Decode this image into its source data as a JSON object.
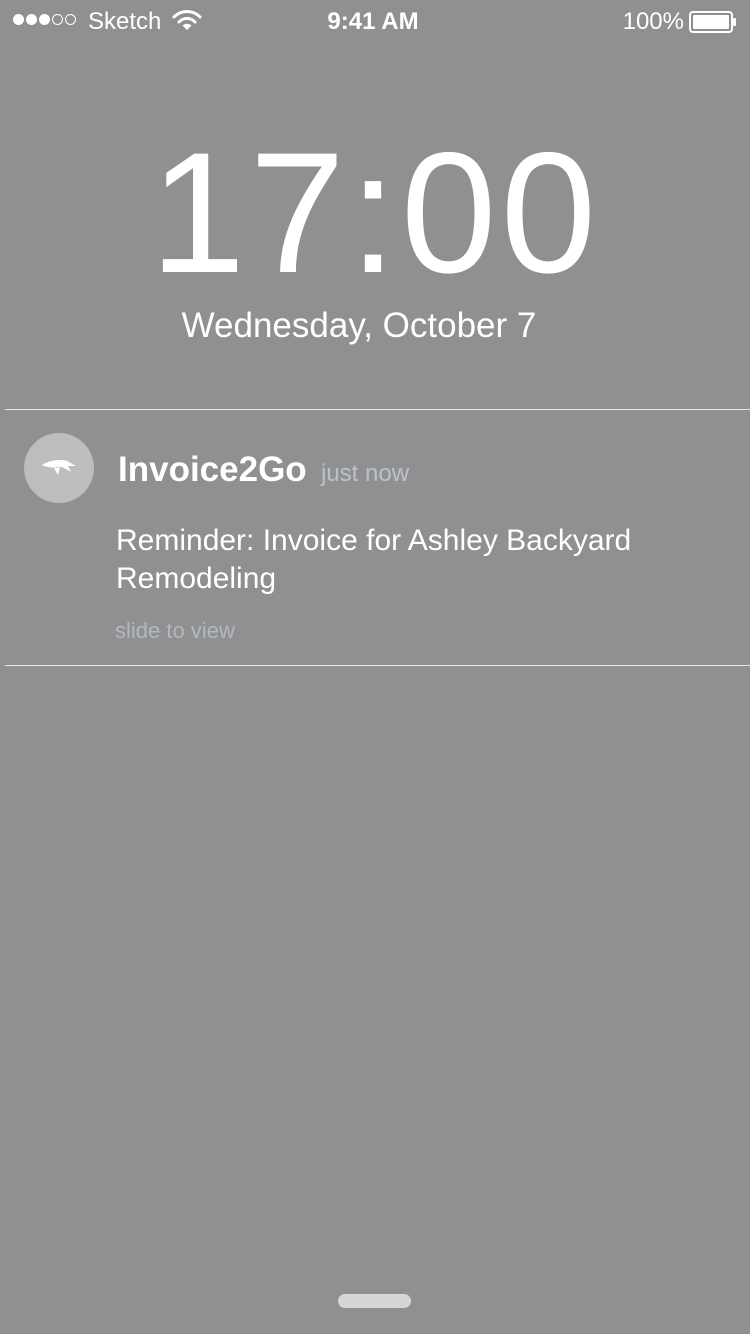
{
  "status_bar": {
    "carrier": "Sketch",
    "time": "9:41 AM",
    "battery": "100%",
    "battery_level": 1.0,
    "signal_bars_filled": 3,
    "signal_bars_total": 5,
    "signal_icon": "signal-dots-icon",
    "wifi_icon": "wifi-icon",
    "battery_icon": "battery-icon"
  },
  "lock_screen": {
    "time": "17:00",
    "date": "Wednesday, October 7"
  },
  "notification": {
    "app_name": "Invoice2Go",
    "timestamp": "just now",
    "message": "Reminder: Invoice for Ashley Backyard Remodeling",
    "hint": "slide to view",
    "app_icon": "invoice2go-bird-icon"
  },
  "colors": {
    "background": "#909090",
    "text": "#ffffff",
    "muted_text": "#b9c2cc"
  }
}
